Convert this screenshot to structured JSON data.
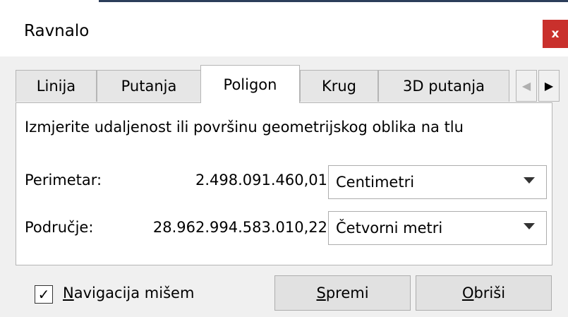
{
  "window": {
    "title": "Ravnalo",
    "close_glyph": "x"
  },
  "tabs": [
    {
      "label": "Linija"
    },
    {
      "label": "Putanja"
    },
    {
      "label": "Poligon",
      "active": true
    },
    {
      "label": "Krug"
    },
    {
      "label": "3D putanja"
    }
  ],
  "tab_scroll": {
    "left_glyph": "◀",
    "right_glyph": "▶"
  },
  "panel": {
    "description": "Izmjerite udaljenost ili površinu geometrijskog oblika na tlu",
    "perimeter": {
      "label": "Perimetar:",
      "value": "2.498.091.460,01",
      "unit": "Centimetri"
    },
    "area": {
      "label": "Područje:",
      "value": "28.962.994.583.010,22",
      "unit": "Četvorni metri"
    }
  },
  "footer": {
    "checkbox": {
      "label_mnemonic": "N",
      "label_rest": "avigacija mišem",
      "checked": true,
      "mark": "✓"
    },
    "save": {
      "mnemonic": "S",
      "rest": "premi"
    },
    "clear": {
      "mnemonic": "O",
      "rest": "briši"
    }
  }
}
